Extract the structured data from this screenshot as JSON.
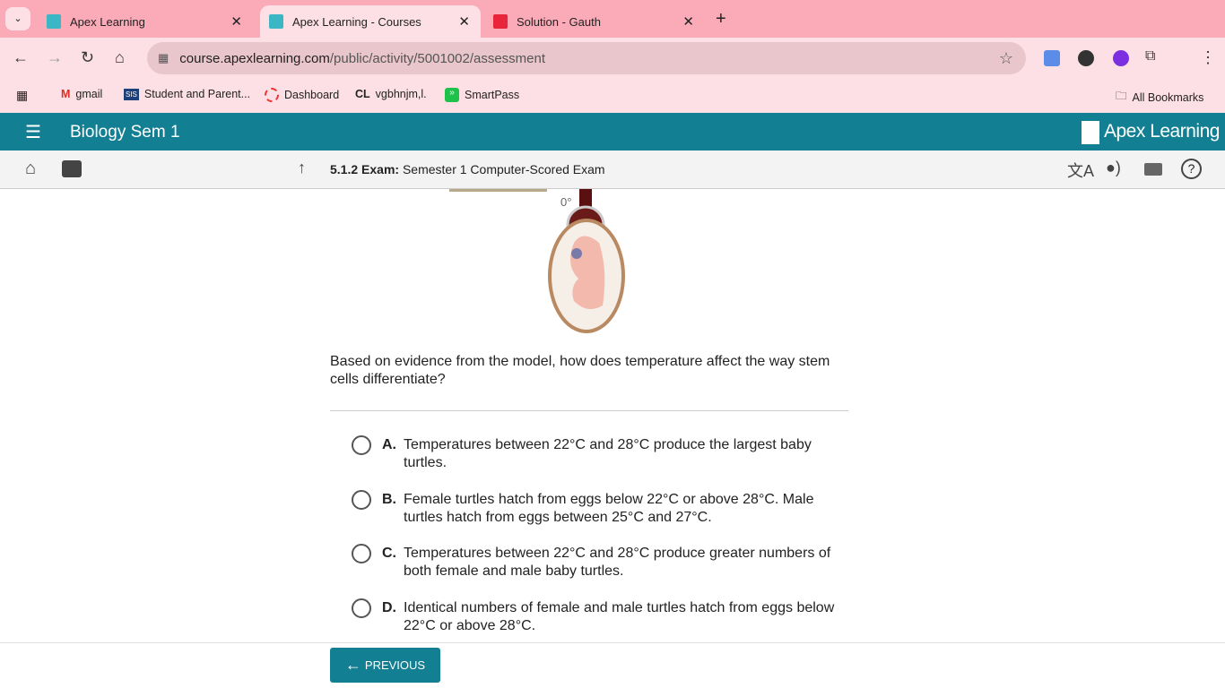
{
  "tabs": [
    {
      "title": "Apex Learning"
    },
    {
      "title": "Apex Learning - Courses",
      "active": true
    },
    {
      "title": "Solution - Gauth"
    }
  ],
  "url": {
    "host": "course.apexlearning.com",
    "path": "/public/activity/5001002/assessment"
  },
  "bookmarks": [
    "gmail",
    "Student and Parent...",
    "Dashboard",
    "vgbhnjm,l.",
    "SmartPass"
  ],
  "all_bookmarks": "All Bookmarks",
  "header": {
    "course": "Biology Sem 1",
    "logo": "Apex Learning"
  },
  "subheader": {
    "number": "5.1.2",
    "type": "Exam:",
    "title": "Semester 1 Computer-Scored Exam"
  },
  "figure": {
    "temp_label": "0°"
  },
  "question": "Based on evidence from the model, how does temperature affect the way stem cells differentiate?",
  "options": [
    {
      "letter": "A.",
      "text": "Temperatures between 22°C and 28°C produce the largest baby turtles."
    },
    {
      "letter": "B.",
      "text": "Female turtles hatch from eggs below 22°C or above 28°C. Male turtles hatch from eggs between 25°C and 27°C."
    },
    {
      "letter": "C.",
      "text": "Temperatures between 22°C and 28°C produce greater numbers of both female and male baby turtles."
    },
    {
      "letter": "D.",
      "text": "Identical numbers of female and male turtles hatch from eggs below 22°C or above 28°C."
    }
  ],
  "footer": {
    "previous": "PREVIOUS"
  },
  "colors": {
    "brand": "#137f92",
    "tabbar": "#fbaab8"
  }
}
